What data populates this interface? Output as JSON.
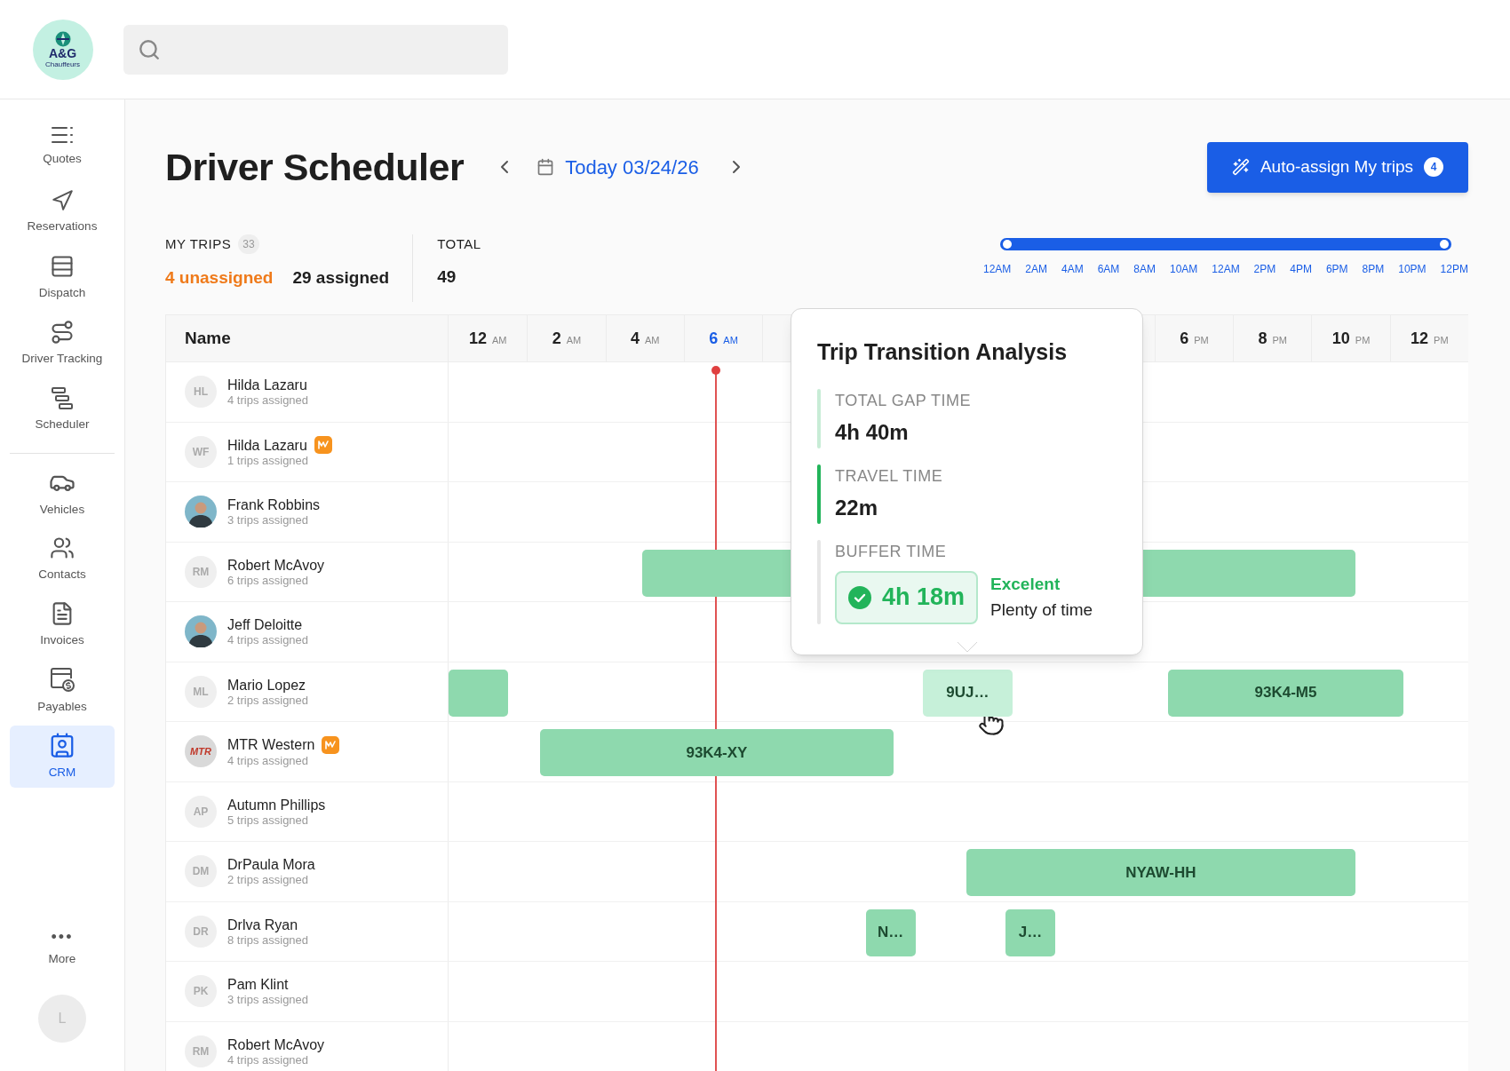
{
  "logo": {
    "title": "A&G",
    "subtitle": "Chauffeurs"
  },
  "sidebar": {
    "groups": [
      [
        {
          "label": "Quotes",
          "selected": false
        },
        {
          "label": "Reservations",
          "selected": false
        },
        {
          "label": "Dispatch",
          "selected": false
        },
        {
          "label": "Driver Tracking",
          "selected": false
        },
        {
          "label": "Scheduler",
          "selected": false
        }
      ],
      [
        {
          "label": "Vehicles",
          "selected": false
        },
        {
          "label": "Contacts",
          "selected": false
        },
        {
          "label": "Invoices",
          "selected": false
        },
        {
          "label": "Payables",
          "selected": false
        },
        {
          "label": "CRM",
          "selected": true
        }
      ]
    ],
    "more": {
      "glyph": "•••",
      "label": "More"
    },
    "user": {
      "initial": "L"
    }
  },
  "header": {
    "title": "Driver Scheduler",
    "date": "Today 03/24/26",
    "action": {
      "label": "Auto-assign My trips",
      "count": "4"
    }
  },
  "stats": {
    "my_trips": {
      "label": "MY TRIPS",
      "count": "33",
      "unassigned": "4 unassigned",
      "assigned": "29 assigned"
    },
    "total": {
      "label": "TOTAL",
      "value": "49"
    }
  },
  "timeline_range": {
    "thumbs": [
      {
        "level": 0
      },
      {
        "level": 1
      }
    ],
    "ticks": [
      "12AM",
      "2AM",
      "4AM",
      "6AM",
      "8AM",
      "10AM",
      "12AM",
      "2PM",
      "4PM",
      "6PM",
      "8PM",
      "10PM",
      "12PM"
    ]
  },
  "table": {
    "name_heading": "Name",
    "hours": [
      {
        "number": "12",
        "period": "AM",
        "selected": false
      },
      {
        "number": "2",
        "period": "AM",
        "selected": false
      },
      {
        "number": "4",
        "period": "AM",
        "selected": false
      },
      {
        "number": "6",
        "period": "AM",
        "selected": true
      },
      {
        "number": "6",
        "period": "PM",
        "selected": false
      },
      {
        "number": "8",
        "period": "PM",
        "selected": false
      },
      {
        "number": "10",
        "period": "PM",
        "selected": false
      },
      {
        "number": "12",
        "period": "PM",
        "selected": false
      }
    ],
    "rows": [
      {
        "avatar": {
          "kind": "initials",
          "text": "HL"
        },
        "name": "Hilda Lazaru",
        "trips_text": "4 trips assigned",
        "badge": false,
        "trips": []
      },
      {
        "avatar": {
          "kind": "initials",
          "text": "WF"
        },
        "name": "Hilda Lazaru",
        "trips_text": "1 trips assigned",
        "badge": true,
        "trips": []
      },
      {
        "avatar": {
          "kind": "photo"
        },
        "name": "Frank Robbins",
        "trips_text": "3 trips assigned",
        "badge": false,
        "trips": []
      },
      {
        "avatar": {
          "kind": "initials",
          "text": "RM"
        },
        "name": "Robert McAvoy",
        "trips_text": "6 trips assigned",
        "badge": false,
        "trips": [
          {
            "hovered": false
          }
        ]
      },
      {
        "avatar": {
          "kind": "photo"
        },
        "name": "Jeff Deloitte",
        "trips_text": "4 trips assigned",
        "badge": false,
        "trips": []
      },
      {
        "avatar": {
          "kind": "initials",
          "text": "ML"
        },
        "name": "Mario Lopez",
        "trips_text": "2 trips assigned",
        "badge": false,
        "trips": [
          {
            "hovered": false
          },
          {
            "label": "9UJ…",
            "hovered": true
          },
          {
            "label": "93K4-M5",
            "hovered": false
          }
        ]
      },
      {
        "avatar": {
          "kind": "logo",
          "text": "MTR"
        },
        "name": "MTR Western",
        "trips_text": "4 trips assigned",
        "badge": true,
        "trips": [
          {
            "label": "93K4-XY",
            "hovered": false
          }
        ]
      },
      {
        "avatar": {
          "kind": "initials",
          "text": "AP"
        },
        "name": "Autumn Phillips",
        "trips_text": "5 trips assigned",
        "badge": false,
        "trips": []
      },
      {
        "avatar": {
          "kind": "initials",
          "text": "DM"
        },
        "name": "DrPaula Mora",
        "trips_text": "2 trips assigned",
        "badge": false,
        "trips": [
          {
            "label": "NYAW-HH",
            "hovered": false
          }
        ]
      },
      {
        "avatar": {
          "kind": "initials",
          "text": "DR"
        },
        "name": "Drlva Ryan",
        "trips_text": "8 trips assigned",
        "badge": false,
        "trips": [
          {
            "label": "N…",
            "hovered": false
          },
          {
            "label": "J…",
            "hovered": false
          }
        ]
      },
      {
        "avatar": {
          "kind": "initials",
          "text": "PK"
        },
        "name": "Pam Klint",
        "trips_text": "3 trips assigned",
        "badge": false,
        "trips": []
      },
      {
        "avatar": {
          "kind": "initials",
          "text": "RM"
        },
        "name": "Robert McAvoy",
        "trips_text": "4 trips assigned",
        "badge": false,
        "trips": []
      }
    ]
  },
  "tooltip": {
    "title": "Trip Transition Analysis",
    "sections": [
      {
        "kind": "value",
        "label": "TOTAL GAP TIME",
        "value": "4h 40m",
        "color": "#c8ecd6"
      },
      {
        "kind": "value",
        "label": "TRAVEL TIME",
        "value": "22m",
        "color": "#22b45a"
      },
      {
        "kind": "rating",
        "label": "BUFFER TIME",
        "value": "4h 18m",
        "color": "#e6e6e6",
        "rating": "Excelent",
        "note": "Plenty of time"
      }
    ]
  }
}
